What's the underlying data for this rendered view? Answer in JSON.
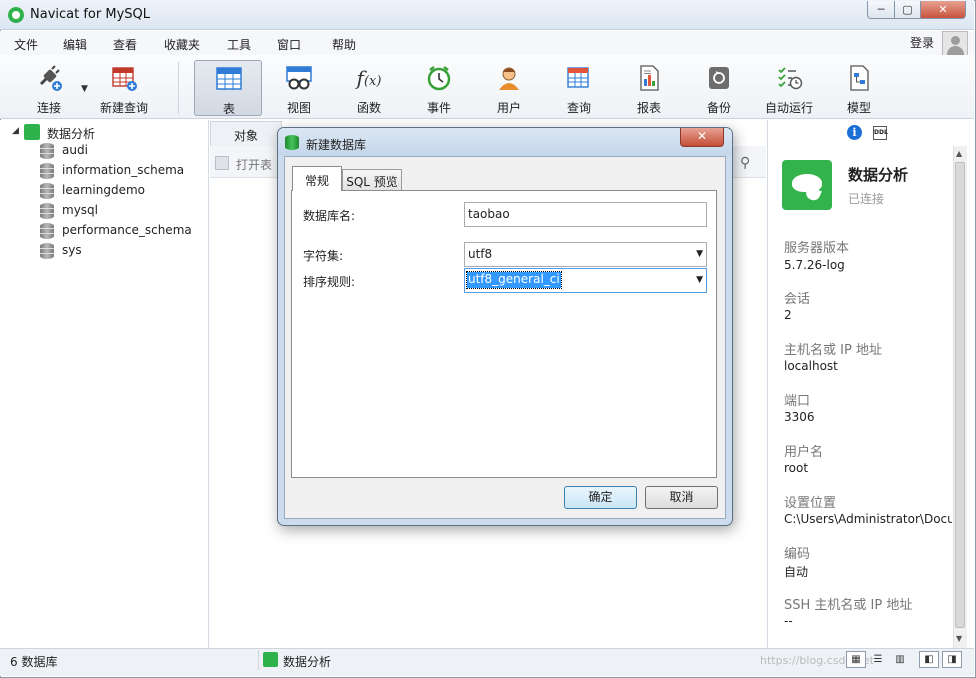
{
  "window": {
    "title": "Navicat for MySQL",
    "min": "─",
    "max": "▢",
    "close": "✕"
  },
  "menu": [
    "文件",
    "编辑",
    "查看",
    "收藏夹",
    "工具",
    "窗口",
    "帮助"
  ],
  "login": "登录",
  "toolbar": [
    {
      "label": "连接",
      "icon": "plug-icon"
    },
    {
      "label": "新建查询",
      "icon": "new-query-icon"
    },
    {
      "label": "表",
      "icon": "table-icon",
      "active": true
    },
    {
      "label": "视图",
      "icon": "view-icon"
    },
    {
      "label": "函数",
      "icon": "function-icon"
    },
    {
      "label": "事件",
      "icon": "clock-icon"
    },
    {
      "label": "用户",
      "icon": "user-icon"
    },
    {
      "label": "查询",
      "icon": "query-icon"
    },
    {
      "label": "报表",
      "icon": "report-icon"
    },
    {
      "label": "备份",
      "icon": "backup-icon"
    },
    {
      "label": "自动运行",
      "icon": "schedule-icon"
    },
    {
      "label": "模型",
      "icon": "model-icon"
    }
  ],
  "tree": {
    "connection": "数据分析",
    "databases": [
      "audi",
      "information_schema",
      "learningdemo",
      "mysql",
      "performance_schema",
      "sys"
    ]
  },
  "main": {
    "tab": "对象",
    "open_table": "打开表"
  },
  "info": {
    "name": "数据分析",
    "status": "已连接",
    "props": [
      {
        "k": "服务器版本",
        "v": "5.7.26-log"
      },
      {
        "k": "会话",
        "v": "2"
      },
      {
        "k": "主机名或 IP 地址",
        "v": "localhost"
      },
      {
        "k": "端口",
        "v": "3306"
      },
      {
        "k": "用户名",
        "v": "root"
      },
      {
        "k": "设置位置",
        "v": "C:\\Users\\Administrator\\Documents"
      },
      {
        "k": "编码",
        "v": "自动"
      },
      {
        "k": "SSH 主机名或 IP 地址",
        "v": "--"
      }
    ]
  },
  "status": {
    "count": "6 数据库",
    "connection": "数据分析",
    "watermark": "https://blog.csdn.net"
  },
  "dialog": {
    "title": "新建数据库",
    "close": "✕",
    "tabs": [
      "常规",
      "SQL 预览"
    ],
    "fields": {
      "db_name_label": "数据库名:",
      "db_name_value": "taobao",
      "charset_label": "字符集:",
      "charset_value": "utf8",
      "collation_label": "排序规则:",
      "collation_value": "utf8_general_ci"
    },
    "ok": "确定",
    "cancel": "取消"
  },
  "colors": {
    "accent": "#2fb24c",
    "selection": "#3399ff"
  }
}
